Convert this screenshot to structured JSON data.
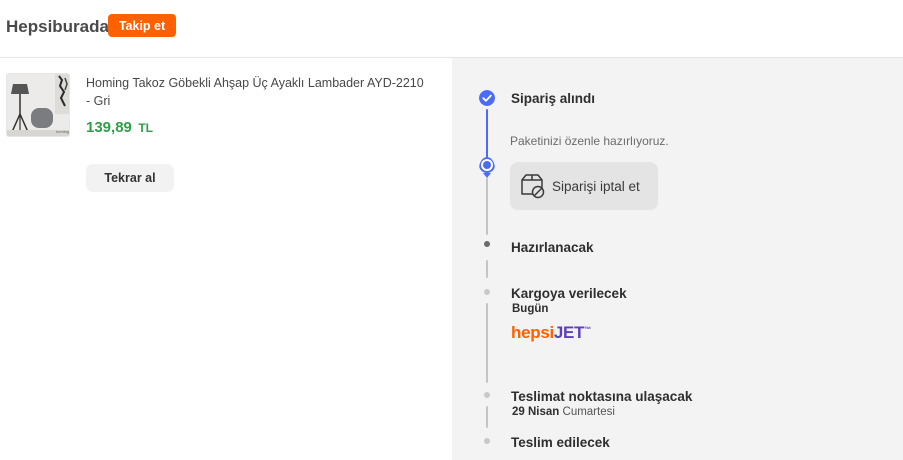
{
  "header": {
    "seller_name": "Hepsiburada",
    "follow_label": "Takip et"
  },
  "product": {
    "title": "Homing Takoz Göbekli Ahşap Üç Ayaklı Lambader AYD-2210 - Gri",
    "price": "139,89",
    "currency": "TL",
    "thumb_caption": "homing",
    "rebuy_label": "Tekrar al"
  },
  "tracking": {
    "steps": [
      {
        "title": "Sipariş alındı",
        "state": "done"
      },
      {
        "title": "",
        "state": "current",
        "description": "Paketinizi özenle hazırlıyoruz.",
        "action_label": "Siparişi iptal et",
        "action_icon": "package-cancel-icon"
      },
      {
        "title": "Hazırlanacak",
        "state": "next"
      },
      {
        "title": "Kargoya verilecek",
        "state": "pending",
        "sub": "Bugün",
        "carrier": {
          "part1": "hepsi",
          "part2": "JET",
          "mark": "™"
        }
      },
      {
        "title": "Teslimat noktasına ulaşacak",
        "state": "pending",
        "sub_bold": "29 Nisan",
        "sub_rest": " Cumartesi"
      },
      {
        "title": "Teslim edilecek",
        "state": "pending"
      }
    ]
  },
  "colors": {
    "brand_orange": "#ff6000",
    "price_green": "#2e9f47",
    "progress_blue": "#4a6cf7",
    "hepsijet_purple": "#5d3ebc"
  }
}
